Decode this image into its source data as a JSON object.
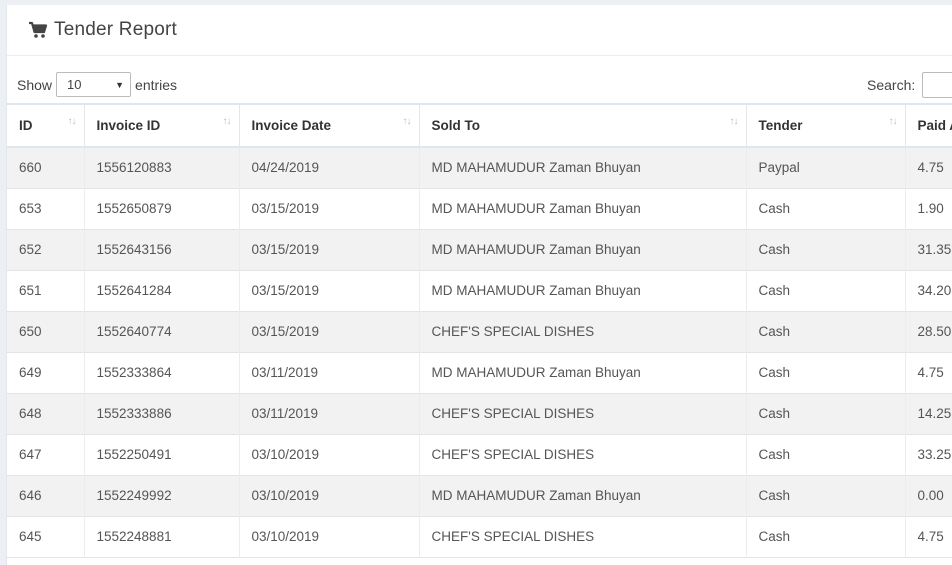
{
  "header": {
    "title": "Tender Report",
    "icon": "shopping-cart-icon"
  },
  "controls": {
    "show_label": "Show",
    "entries_value": "10",
    "entries_label": "entries",
    "search_label": "Search:"
  },
  "table": {
    "columns": [
      "ID",
      "Invoice ID",
      "Invoice Date",
      "Sold To",
      "Tender",
      "Paid A"
    ],
    "rows": [
      [
        "660",
        "1556120883",
        "04/24/2019",
        "MD MAHAMUDUR Zaman Bhuyan",
        "Paypal",
        "4.75"
      ],
      [
        "653",
        "1552650879",
        "03/15/2019",
        "MD MAHAMUDUR Zaman Bhuyan",
        "Cash",
        "1.90"
      ],
      [
        "652",
        "1552643156",
        "03/15/2019",
        "MD MAHAMUDUR Zaman Bhuyan",
        "Cash",
        "31.35"
      ],
      [
        "651",
        "1552641284",
        "03/15/2019",
        "MD MAHAMUDUR Zaman Bhuyan",
        "Cash",
        "34.20"
      ],
      [
        "650",
        "1552640774",
        "03/15/2019",
        "CHEF'S SPECIAL DISHES",
        "Cash",
        "28.50"
      ],
      [
        "649",
        "1552333864",
        "03/11/2019",
        "MD MAHAMUDUR Zaman Bhuyan",
        "Cash",
        "4.75"
      ],
      [
        "648",
        "1552333886",
        "03/11/2019",
        "CHEF'S SPECIAL DISHES",
        "Cash",
        "14.25"
      ],
      [
        "647",
        "1552250491",
        "03/10/2019",
        "CHEF'S SPECIAL DISHES",
        "Cash",
        "33.25"
      ],
      [
        "646",
        "1552249992",
        "03/10/2019",
        "MD MAHAMUDUR Zaman Bhuyan",
        "Cash",
        "0.00"
      ],
      [
        "645",
        "1552248881",
        "03/10/2019",
        "CHEF'S SPECIAL DISHES",
        "Cash",
        "4.75"
      ]
    ]
  }
}
